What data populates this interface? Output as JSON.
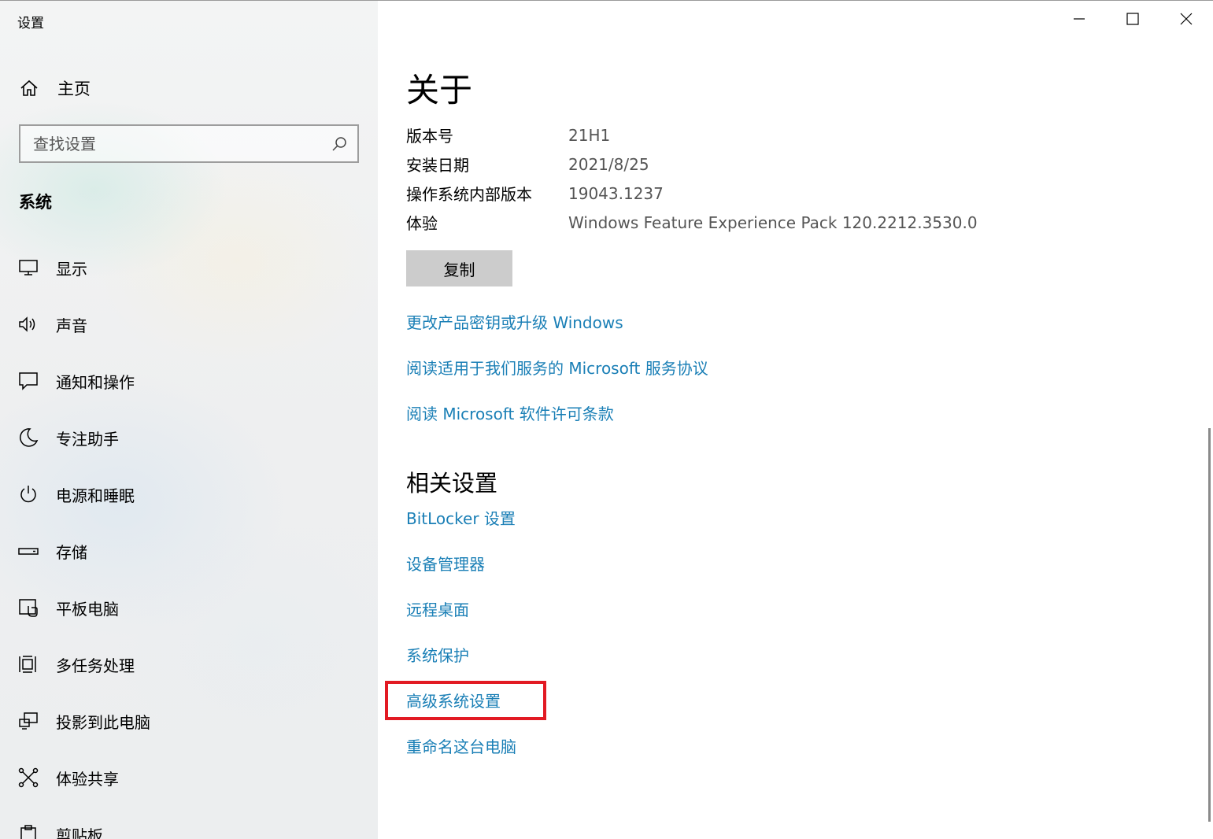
{
  "window": {
    "app_title": "设置",
    "caption_buttons": {
      "minimize": "minimize-icon",
      "maximize": "maximize-icon",
      "close": "close-icon"
    }
  },
  "sidebar": {
    "home_label": "主页",
    "search_placeholder": "查找设置",
    "section_title": "系统",
    "items": [
      {
        "label": "显示",
        "icon": "display-icon"
      },
      {
        "label": "声音",
        "icon": "speaker-icon"
      },
      {
        "label": "通知和操作",
        "icon": "notification-icon"
      },
      {
        "label": "专注助手",
        "icon": "moon-icon"
      },
      {
        "label": "电源和睡眠",
        "icon": "power-icon"
      },
      {
        "label": "存储",
        "icon": "storage-icon"
      },
      {
        "label": "平板电脑",
        "icon": "tablet-icon"
      },
      {
        "label": "多任务处理",
        "icon": "multitasking-icon"
      },
      {
        "label": "投影到此电脑",
        "icon": "projection-icon"
      },
      {
        "label": "体验共享",
        "icon": "shared-experiences-icon"
      },
      {
        "label": "剪贴板",
        "icon": "clipboard-icon"
      }
    ]
  },
  "main": {
    "title": "关于",
    "properties": [
      {
        "key": "版本号",
        "value": "21H1"
      },
      {
        "key": "安装日期",
        "value": "2021/8/25"
      },
      {
        "key": "操作系统内部版本",
        "value": "19043.1237"
      },
      {
        "key": "体验",
        "value": "Windows Feature Experience Pack 120.2212.3530.0"
      }
    ],
    "copy_label": "复制",
    "links": [
      "更改产品密钥或升级 Windows",
      "阅读适用于我们服务的 Microsoft 服务协议",
      "阅读 Microsoft 软件许可条款"
    ],
    "related_title": "相关设置",
    "related_links": [
      "BitLocker 设置",
      "设备管理器",
      "远程桌面",
      "系统保护",
      "高级系统设置",
      "重命名这台电脑"
    ],
    "highlighted_link": "高级系统设置",
    "colors": {
      "link": "#1a7fb6",
      "highlight": "#e21a23",
      "button": "#cccccc"
    }
  }
}
